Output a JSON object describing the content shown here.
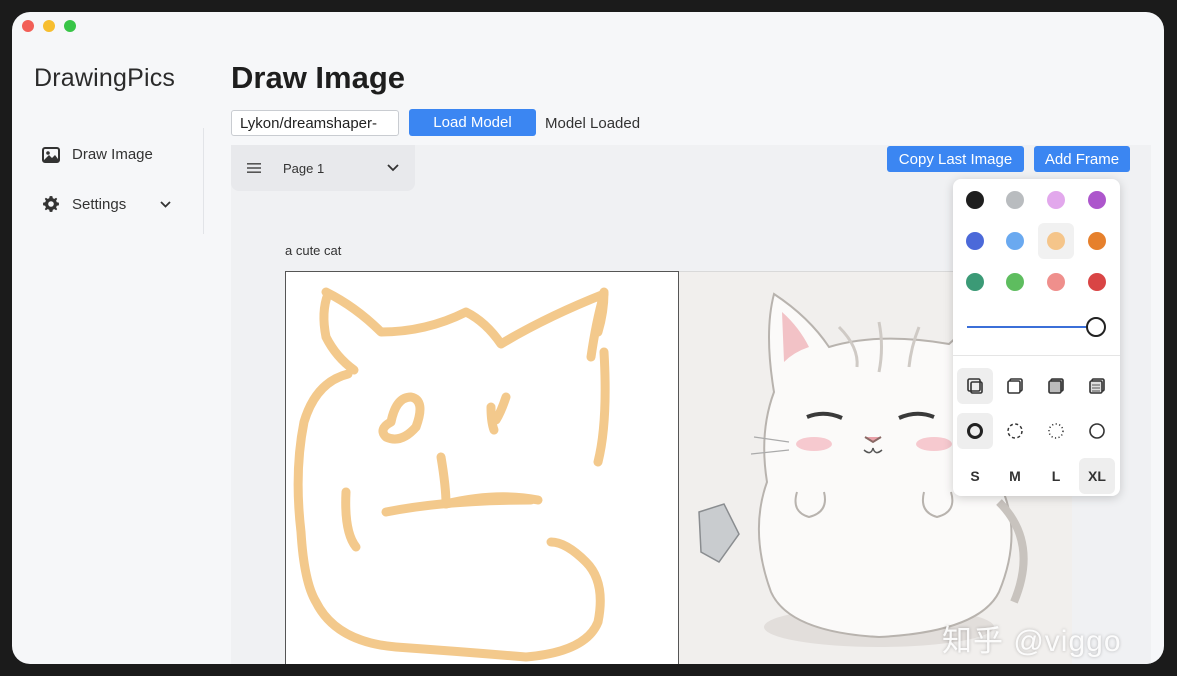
{
  "app": {
    "name": "DrawingPics"
  },
  "sidebar": {
    "items": [
      {
        "label": "Draw Image",
        "icon": "image-icon"
      },
      {
        "label": "Settings",
        "icon": "gear-icon"
      }
    ]
  },
  "header": {
    "title": "Draw Image"
  },
  "model": {
    "input_value": "Lykon/dreamshaper-",
    "load_label": "Load Model",
    "status": "Model Loaded"
  },
  "toolbar": {
    "page_label": "Page 1",
    "copy_label": "Copy Last Image",
    "add_frame_label": "Add Frame"
  },
  "canvas": {
    "prompt": "a cute cat"
  },
  "palette": {
    "colors": [
      "#1e1e1e",
      "#b9bcbf",
      "#e2a8ec",
      "#ad56cc",
      "#4b69d9",
      "#6aa9f0",
      "#f5c58a",
      "#e6802c",
      "#3b9a76",
      "#5ebd5f",
      "#ef8f8c",
      "#d94545"
    ],
    "selected_color": "#f5c58a",
    "stroke_level": 1.0,
    "sizes": [
      "S",
      "M",
      "L",
      "XL"
    ],
    "selected_size": "XL"
  },
  "watermark": "知乎 @viggo"
}
